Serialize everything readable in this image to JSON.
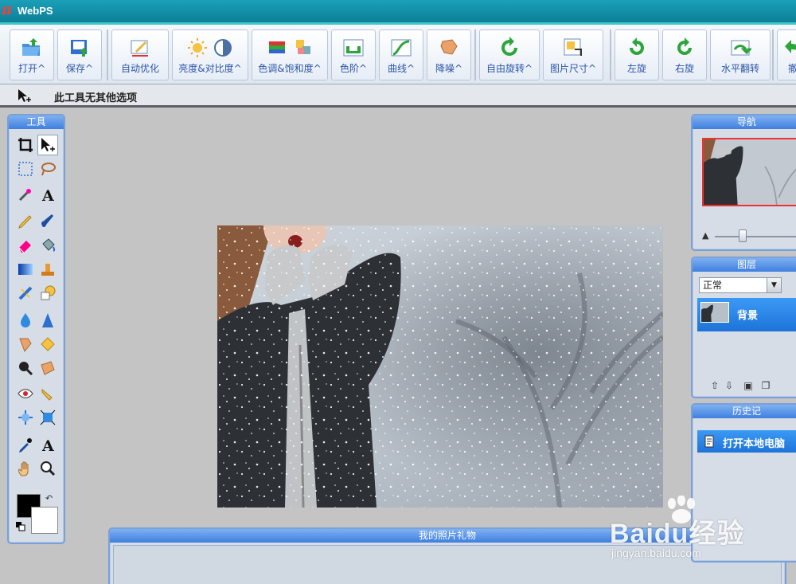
{
  "app": {
    "title": "WebPS",
    "logo_glyph": "π"
  },
  "toolbar": {
    "open": "打开^",
    "save": "保存^",
    "auto_optimize": "自动优化",
    "brightness_contrast": "亮度&对比度^",
    "hue_saturation": "色调&饱和度^",
    "levels": "色阶^",
    "curves": "曲线^",
    "denoise": "降噪^",
    "free_rotate": "自由旋转^",
    "image_size": "图片尺寸^",
    "rotate_left": "左旋",
    "rotate_right": "右旋",
    "flip_horizontal": "水平翻转",
    "undo_partial": "撤"
  },
  "options_bar": {
    "text": "此工具无其他选项"
  },
  "panels": {
    "tools": {
      "title": "工具"
    },
    "navigator": {
      "title": "导航"
    },
    "layers": {
      "title": "图层",
      "blend_mode": "正常",
      "layer_name": "背景"
    },
    "history": {
      "title": "历史记",
      "item": "打开本地电脑"
    },
    "gift": {
      "title": "我的照片礼物"
    }
  },
  "colors": {
    "foreground": "#000000",
    "background": "#ffffff",
    "accent": "#3f7fe0",
    "titlebar": "#0d7f98"
  },
  "watermark": {
    "brand": "Baidu经验",
    "url": "jingyan.baidu.com"
  }
}
